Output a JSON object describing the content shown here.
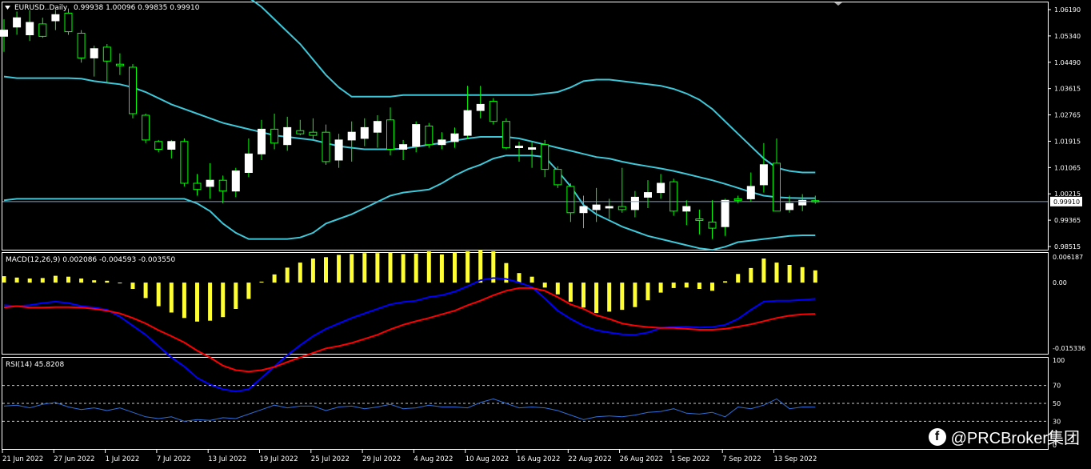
{
  "colors": {
    "background": "#000000",
    "panel_border": "#ffffff",
    "bull_candle": "#ffffff",
    "bear_candle": "#000000",
    "wick": "#00ff00",
    "bollinger": "#3ec7d8",
    "macd_hist": "#ffff33",
    "macd_line": "#0000ff",
    "signal_line": "#ff0000",
    "rsi_line": "#2f6fd6",
    "price_line": "#7f9fbf"
  },
  "price_panel": {
    "header_icon": "triangle-down-icon",
    "title": "EURUSD..Daily",
    "ohlc": "0.99938 1.00096 0.99835 0.99910",
    "current_price": "0.99910",
    "axis_labels": [
      "1.06190",
      "1.05340",
      "1.04490",
      "1.03615",
      "1.02765",
      "1.01915",
      "1.01065",
      "1.00215",
      "0.99365",
      "0.98515"
    ]
  },
  "macd_panel": {
    "title": "MACD(12,26,9) 0.002086 -0.004593 -0.003550",
    "axis_labels": [
      "0.006187",
      "0.00",
      "-0.015336"
    ]
  },
  "rsi_panel": {
    "title": "RSI(14) 45.8208",
    "axis_labels": [
      "100",
      "70",
      "50",
      "30",
      "0"
    ]
  },
  "time_axis": [
    "21 Jun 2022",
    "27 Jun 2022",
    "1 Jul 2022",
    "7 Jul 2022",
    "13 Jul 2022",
    "19 Jul 2022",
    "25 Jul 2022",
    "29 Jul 2022",
    "4 Aug 2022",
    "10 Aug 2022",
    "16 Aug 2022",
    "22 Aug 2022",
    "26 Aug 2022",
    "1 Sep 2022",
    "7 Sep 2022",
    "13 Sep 2022"
  ],
  "watermark": {
    "icon": "facebook-icon",
    "icon_glyph": "f",
    "text": "@PRCBroker集团"
  },
  "chart_data": [
    {
      "type": "candlestick",
      "title": "EURUSD..Daily",
      "ylim": [
        0.9838,
        1.0632
      ],
      "candles": [
        {
          "o": 1.0525,
          "h": 1.058,
          "l": 1.0475,
          "c": 1.0545
        },
        {
          "o": 1.0555,
          "h": 1.0605,
          "l": 1.053,
          "c": 1.0585
        },
        {
          "o": 1.053,
          "h": 1.061,
          "l": 1.051,
          "c": 1.057
        },
        {
          "o": 1.0565,
          "h": 1.0585,
          "l": 1.052,
          "c": 1.0525
        },
        {
          "o": 1.0575,
          "h": 1.061,
          "l": 1.0545,
          "c": 1.0595
        },
        {
          "o": 1.06,
          "h": 1.0615,
          "l": 1.053,
          "c": 1.054
        },
        {
          "o": 1.0535,
          "h": 1.0545,
          "l": 1.044,
          "c": 1.0455
        },
        {
          "o": 1.0455,
          "h": 1.0495,
          "l": 1.0395,
          "c": 1.0485
        },
        {
          "o": 1.049,
          "h": 1.05,
          "l": 1.0375,
          "c": 1.0445
        },
        {
          "o": 1.0435,
          "h": 1.047,
          "l": 1.04,
          "c": 1.043
        },
        {
          "o": 1.0425,
          "h": 1.0435,
          "l": 1.026,
          "c": 1.0275
        },
        {
          "o": 1.027,
          "h": 1.0275,
          "l": 1.018,
          "c": 1.019
        },
        {
          "o": 1.0185,
          "h": 1.019,
          "l": 1.015,
          "c": 1.016
        },
        {
          "o": 1.016,
          "h": 1.019,
          "l": 1.013,
          "c": 1.0185
        },
        {
          "o": 1.0185,
          "h": 1.0195,
          "l": 1.004,
          "c": 1.005
        },
        {
          "o": 1.005,
          "h": 1.008,
          "l": 1.001,
          "c": 1.003
        },
        {
          "o": 1.004,
          "h": 1.0115,
          "l": 1.0,
          "c": 1.006
        },
        {
          "o": 1.006,
          "h": 1.0075,
          "l": 0.9985,
          "c": 1.0025
        },
        {
          "o": 1.0025,
          "h": 1.01,
          "l": 1.0005,
          "c": 1.009
        },
        {
          "o": 1.0085,
          "h": 1.0195,
          "l": 1.007,
          "c": 1.0145
        },
        {
          "o": 1.0145,
          "h": 1.0255,
          "l": 1.0125,
          "c": 1.0225
        },
        {
          "o": 1.0225,
          "h": 1.0275,
          "l": 1.016,
          "c": 1.018
        },
        {
          "o": 1.0175,
          "h": 1.0265,
          "l": 1.0155,
          "c": 1.023
        },
        {
          "o": 1.022,
          "h": 1.0255,
          "l": 1.0205,
          "c": 1.021
        },
        {
          "o": 1.0215,
          "h": 1.026,
          "l": 1.019,
          "c": 1.0205
        },
        {
          "o": 1.0215,
          "h": 1.024,
          "l": 1.011,
          "c": 1.012
        },
        {
          "o": 1.0125,
          "h": 1.021,
          "l": 1.01,
          "c": 1.019
        },
        {
          "o": 1.019,
          "h": 1.025,
          "l": 1.012,
          "c": 1.0215
        },
        {
          "o": 1.0195,
          "h": 1.026,
          "l": 1.017,
          "c": 1.023
        },
        {
          "o": 1.0215,
          "h": 1.027,
          "l": 1.0165,
          "c": 1.025
        },
        {
          "o": 1.0255,
          "h": 1.0295,
          "l": 1.014,
          "c": 1.016
        },
        {
          "o": 1.016,
          "h": 1.019,
          "l": 1.0125,
          "c": 1.0175
        },
        {
          "o": 1.017,
          "h": 1.025,
          "l": 1.015,
          "c": 1.024
        },
        {
          "o": 1.0235,
          "h": 1.0245,
          "l": 1.0165,
          "c": 1.0175
        },
        {
          "o": 1.0175,
          "h": 1.0215,
          "l": 1.016,
          "c": 1.019
        },
        {
          "o": 1.0185,
          "h": 1.023,
          "l": 1.0165,
          "c": 1.021
        },
        {
          "o": 1.0205,
          "h": 1.0365,
          "l": 1.0195,
          "c": 1.0285
        },
        {
          "o": 1.0285,
          "h": 1.0365,
          "l": 1.026,
          "c": 1.0305
        },
        {
          "o": 1.0315,
          "h": 1.0325,
          "l": 1.024,
          "c": 1.025
        },
        {
          "o": 1.025,
          "h": 1.026,
          "l": 1.016,
          "c": 1.0165
        },
        {
          "o": 1.0165,
          "h": 1.0185,
          "l": 1.012,
          "c": 1.017
        },
        {
          "o": 1.016,
          "h": 1.0185,
          "l": 1.01,
          "c": 1.0165
        },
        {
          "o": 1.0175,
          "h": 1.019,
          "l": 1.007,
          "c": 1.0095
        },
        {
          "o": 1.0095,
          "h": 1.0105,
          "l": 1.0035,
          "c": 1.0045
        },
        {
          "o": 1.004,
          "h": 1.005,
          "l": 0.9925,
          "c": 0.9955
        },
        {
          "o": 0.9955,
          "h": 1.001,
          "l": 0.9905,
          "c": 0.9975
        },
        {
          "o": 0.9965,
          "h": 1.0035,
          "l": 0.9925,
          "c": 0.998
        },
        {
          "o": 0.997,
          "h": 1.0,
          "l": 0.9935,
          "c": 0.9975
        },
        {
          "o": 0.9975,
          "h": 1.01,
          "l": 0.9955,
          "c": 0.9965
        },
        {
          "o": 0.9965,
          "h": 1.0025,
          "l": 0.994,
          "c": 1.0005
        },
        {
          "o": 1.0005,
          "h": 1.006,
          "l": 0.997,
          "c": 1.002
        },
        {
          "o": 1.002,
          "h": 1.008,
          "l": 1.0,
          "c": 1.005
        },
        {
          "o": 1.0055,
          "h": 1.0065,
          "l": 0.9945,
          "c": 0.996
        },
        {
          "o": 0.996,
          "h": 0.9995,
          "l": 0.9915,
          "c": 0.9975
        },
        {
          "o": 0.9935,
          "h": 0.9965,
          "l": 0.9885,
          "c": 0.993
        },
        {
          "o": 0.9925,
          "h": 0.9995,
          "l": 0.987,
          "c": 0.9905
        },
        {
          "o": 0.991,
          "h": 1.0,
          "l": 0.988,
          "c": 0.9995
        },
        {
          "o": 1.0,
          "h": 1.001,
          "l": 0.9985,
          "c": 0.9995
        },
        {
          "o": 1.0,
          "h": 1.0085,
          "l": 0.999,
          "c": 1.004
        },
        {
          "o": 1.0045,
          "h": 1.018,
          "l": 1.002,
          "c": 1.011
        },
        {
          "o": 1.0115,
          "h": 1.0195,
          "l": 0.996,
          "c": 0.996
        },
        {
          "o": 0.9965,
          "h": 1.001,
          "l": 0.9955,
          "c": 0.9985
        },
        {
          "o": 0.998,
          "h": 1.0015,
          "l": 0.996,
          "c": 0.9995
        },
        {
          "o": 0.9994,
          "h": 1.001,
          "l": 0.9984,
          "c": 0.9991
        }
      ],
      "bollinger_upper": [
        1.088,
        1.087,
        1.086,
        1.085,
        1.084,
        1.083,
        1.082,
        1.081,
        1.08,
        1.079,
        1.078,
        1.077,
        1.076,
        1.075,
        1.074,
        1.073,
        1.072,
        1.07,
        1.068,
        1.065,
        1.062,
        1.058,
        1.054,
        1.05,
        1.045,
        1.04,
        1.036,
        1.033,
        1.033,
        1.033,
        1.033,
        1.0335,
        1.0335,
        1.0335,
        1.0335,
        1.0335,
        1.0335,
        1.0335,
        1.0335,
        1.0335,
        1.0335,
        1.0335,
        1.034,
        1.0345,
        1.036,
        1.038,
        1.0385,
        1.0385,
        1.038,
        1.0375,
        1.037,
        1.0365,
        1.0355,
        1.034,
        1.032,
        1.029,
        1.025,
        1.021,
        1.017,
        1.013,
        1.01,
        1.009,
        1.0085,
        1.0085
      ],
      "bollinger_middle": [
        1.0395,
        1.039,
        1.039,
        1.039,
        1.039,
        1.039,
        1.0388,
        1.038,
        1.0375,
        1.037,
        1.036,
        1.0345,
        1.0325,
        1.0305,
        1.029,
        1.0275,
        1.026,
        1.0245,
        1.0235,
        1.0225,
        1.0215,
        1.0205,
        1.02,
        1.0195,
        1.019,
        1.018,
        1.017,
        1.0165,
        1.016,
        1.016,
        1.016,
        1.0162,
        1.0168,
        1.0175,
        1.018,
        1.0188,
        1.0195,
        1.02,
        1.02,
        1.02,
        1.0195,
        1.0185,
        1.0175,
        1.0165,
        1.0155,
        1.0145,
        1.0135,
        1.013,
        1.012,
        1.0112,
        1.0105,
        1.0098,
        1.009,
        1.008,
        1.007,
        1.006,
        1.0048,
        1.0035,
        1.0022,
        1.001,
        1.0005,
        1.0003,
        1.0002,
        1.0002
      ],
      "bollinger_lower": [
        0.9995,
        1.0,
        1.0,
        1.0,
        1.0,
        1.0,
        1.0,
        1.0,
        1.0,
        1.0,
        1.0,
        1.0,
        1.0,
        1.0,
        1.0,
        0.9985,
        0.996,
        0.992,
        0.989,
        0.987,
        0.987,
        0.987,
        0.987,
        0.9875,
        0.989,
        0.992,
        0.9935,
        0.995,
        0.997,
        0.999,
        1.001,
        1.002,
        1.0025,
        1.003,
        1.005,
        1.0075,
        1.0095,
        1.011,
        1.013,
        1.014,
        1.014,
        1.014,
        1.0135,
        1.009,
        1.004,
        0.998,
        0.995,
        0.993,
        0.991,
        0.9895,
        0.988,
        0.987,
        0.986,
        0.985,
        0.984,
        0.9835,
        0.9845,
        0.986,
        0.9865,
        0.987,
        0.9875,
        0.988,
        0.9882,
        0.9882
      ]
    },
    {
      "type": "bar",
      "title": "MACD(12,26,9)",
      "ylim": [
        -0.015336,
        0.006187
      ],
      "histogram": [
        0.0014,
        0.0011,
        0.0009,
        0.001,
        0.0015,
        0.0013,
        0.0009,
        0.0005,
        0.0004,
        -0.0001,
        -0.0014,
        -0.0034,
        -0.0052,
        -0.0066,
        -0.0078,
        -0.0086,
        -0.0084,
        -0.0076,
        -0.0058,
        -0.0036,
        0.0002,
        0.0018,
        0.0033,
        0.0044,
        0.0053,
        0.0056,
        0.0061,
        0.0063,
        0.0065,
        0.0065,
        0.0066,
        0.0063,
        0.0064,
        0.0069,
        0.0062,
        0.0066,
        0.0069,
        0.0072,
        0.0069,
        0.0043,
        0.0021,
        0.0013,
        -0.0011,
        -0.0026,
        -0.0042,
        -0.0055,
        -0.0067,
        -0.0064,
        -0.006,
        -0.0054,
        -0.0039,
        -0.0022,
        -0.0012,
        -0.0011,
        -0.0014,
        -0.0018,
        0.0003,
        0.0019,
        0.0032,
        0.0053,
        0.0044,
        0.0039,
        0.0034,
        0.0027
      ],
      "macd": [
        -0.005,
        -0.0052,
        -0.005,
        -0.0045,
        -0.0042,
        -0.0045,
        -0.0052,
        -0.0055,
        -0.006,
        -0.0075,
        -0.0095,
        -0.0115,
        -0.014,
        -0.0165,
        -0.0185,
        -0.021,
        -0.0225,
        -0.0235,
        -0.024,
        -0.0235,
        -0.021,
        -0.0185,
        -0.016,
        -0.0138,
        -0.0118,
        -0.0102,
        -0.009,
        -0.0078,
        -0.0068,
        -0.0058,
        -0.0048,
        -0.0043,
        -0.004,
        -0.0032,
        -0.0028,
        -0.002,
        -0.0008,
        0.0005,
        0.001,
        0.0008,
        0.0,
        -0.001,
        -0.0035,
        -0.0062,
        -0.008,
        -0.0095,
        -0.0105,
        -0.011,
        -0.0114,
        -0.0115,
        -0.011,
        -0.01,
        -0.0098,
        -0.0097,
        -0.0099,
        -0.0098,
        -0.0093,
        -0.008,
        -0.006,
        -0.0042,
        -0.004,
        -0.004,
        -0.0038,
        -0.0036
      ],
      "signal": [
        -0.0055,
        -0.0052,
        -0.0055,
        -0.0055,
        -0.0054,
        -0.0054,
        -0.0055,
        -0.0058,
        -0.0062,
        -0.0068,
        -0.0078,
        -0.009,
        -0.0105,
        -0.0118,
        -0.0132,
        -0.015,
        -0.0165,
        -0.0183,
        -0.0193,
        -0.0196,
        -0.0193,
        -0.0186,
        -0.0175,
        -0.0165,
        -0.0155,
        -0.0145,
        -0.014,
        -0.0133,
        -0.0124,
        -0.0115,
        -0.0103,
        -0.0093,
        -0.0085,
        -0.0078,
        -0.007,
        -0.0062,
        -0.005,
        -0.004,
        -0.0028,
        -0.0018,
        -0.0012,
        -0.0012,
        -0.0018,
        -0.0032,
        -0.0048,
        -0.0058,
        -0.0072,
        -0.008,
        -0.009,
        -0.0095,
        -0.0098,
        -0.01,
        -0.01,
        -0.0102,
        -0.0104,
        -0.0104,
        -0.0102,
        -0.0097,
        -0.0092,
        -0.0085,
        -0.0078,
        -0.0073,
        -0.007,
        -0.0069
      ]
    },
    {
      "type": "line",
      "title": "RSI(14)",
      "ylim": [
        0,
        100
      ],
      "levels": [
        30,
        50,
        70
      ],
      "values": [
        47,
        48,
        45,
        49,
        51,
        46,
        43,
        45,
        42,
        45,
        40,
        35,
        33,
        35,
        30,
        32,
        31,
        34,
        33,
        38,
        43,
        48,
        45,
        47,
        47,
        42,
        46,
        47,
        44,
        46,
        49,
        44,
        45,
        48,
        46,
        46,
        45,
        51,
        55,
        50,
        45,
        46,
        45,
        42,
        37,
        32,
        35,
        36,
        35,
        37,
        40,
        41,
        44,
        39,
        38,
        40,
        35,
        46,
        44,
        48,
        55,
        44,
        46,
        45.8208
      ]
    }
  ]
}
